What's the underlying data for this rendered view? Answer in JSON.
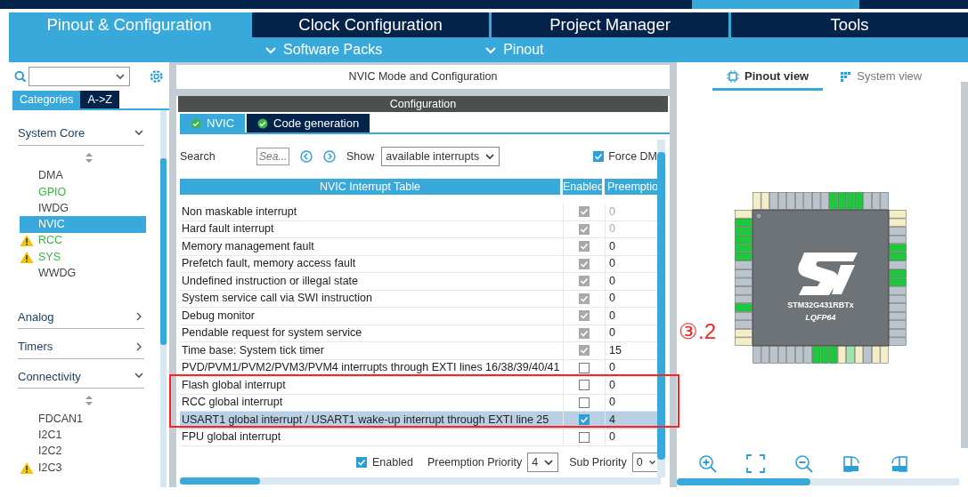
{
  "main_tabs": [
    {
      "label": "Pinout & Configuration",
      "selected": true
    },
    {
      "label": "Clock Configuration",
      "selected": false
    },
    {
      "label": "Project Manager",
      "selected": false
    },
    {
      "label": "Tools",
      "selected": false
    }
  ],
  "sub_menus": [
    {
      "label": "Software Packs"
    },
    {
      "label": "Pinout"
    }
  ],
  "sidebar": {
    "view_tabs": [
      {
        "label": "Categories",
        "selected": true
      },
      {
        "label": "A->Z",
        "selected": false
      }
    ],
    "categories": [
      {
        "label": "System Core",
        "expanded": true,
        "items": [
          {
            "label": "DMA",
            "selected": false,
            "configured": false,
            "warning": false
          },
          {
            "label": "GPIO",
            "selected": false,
            "configured": true,
            "warning": false
          },
          {
            "label": "IWDG",
            "selected": false,
            "configured": false,
            "warning": false
          },
          {
            "label": "NVIC",
            "selected": true,
            "configured": false,
            "warning": false
          },
          {
            "label": "RCC",
            "selected": false,
            "configured": true,
            "warning": true
          },
          {
            "label": "SYS",
            "selected": false,
            "configured": true,
            "warning": true
          },
          {
            "label": "WWDG",
            "selected": false,
            "configured": false,
            "warning": false
          }
        ]
      },
      {
        "label": "Analog",
        "expanded": false
      },
      {
        "label": "Timers",
        "expanded": false
      },
      {
        "label": "Connectivity",
        "expanded": true,
        "items": [
          {
            "label": "FDCAN1",
            "selected": false,
            "configured": false,
            "warning": false
          },
          {
            "label": "I2C1",
            "selected": false,
            "configured": false,
            "warning": false
          },
          {
            "label": "I2C2",
            "selected": false,
            "configured": false,
            "warning": false
          },
          {
            "label": "I2C3",
            "selected": false,
            "configured": false,
            "warning": true
          }
        ]
      }
    ]
  },
  "mode_panel": {
    "title": "NVIC Mode and Configuration",
    "section_title": "Configuration",
    "tabs": [
      {
        "label": "NVIC",
        "selected": true
      },
      {
        "label": "Code generation",
        "selected": false
      }
    ],
    "search": {
      "label": "Search",
      "placeholder": "Sea..."
    },
    "show": {
      "label": "Show",
      "value": "available interrupts"
    },
    "force_dma": {
      "label": "Force DM",
      "checked": true
    },
    "table": {
      "title": "NVIC Interrupt Table",
      "columns": [
        "Enabled",
        "Preemptio"
      ],
      "rows": [
        {
          "name": "Non maskable interrupt",
          "enabled": true,
          "locked": true,
          "priority": "0",
          "priority_locked": true,
          "selected": false
        },
        {
          "name": "Hard fault interrupt",
          "enabled": true,
          "locked": true,
          "priority": "0",
          "priority_locked": true,
          "selected": false
        },
        {
          "name": "Memory management fault",
          "enabled": true,
          "locked": true,
          "priority": "0",
          "priority_locked": false,
          "selected": false
        },
        {
          "name": "Prefetch fault, memory access fault",
          "enabled": true,
          "locked": true,
          "priority": "0",
          "priority_locked": false,
          "selected": false
        },
        {
          "name": "Undefined instruction or illegal state",
          "enabled": true,
          "locked": true,
          "priority": "0",
          "priority_locked": false,
          "selected": false
        },
        {
          "name": "System service call via SWI instruction",
          "enabled": true,
          "locked": true,
          "priority": "0",
          "priority_locked": false,
          "selected": false
        },
        {
          "name": "Debug monitor",
          "enabled": true,
          "locked": true,
          "priority": "0",
          "priority_locked": false,
          "selected": false
        },
        {
          "name": "Pendable request for system service",
          "enabled": true,
          "locked": true,
          "priority": "0",
          "priority_locked": false,
          "selected": false
        },
        {
          "name": "Time base: System tick timer",
          "enabled": true,
          "locked": true,
          "priority": "15",
          "priority_locked": false,
          "selected": false
        },
        {
          "name": "PVD/PVM1/PVM2/PVM3/PVM4 interrupts through EXTI lines 16/38/39/40/41",
          "enabled": false,
          "locked": false,
          "priority": "0",
          "priority_locked": false,
          "selected": false
        },
        {
          "name": "Flash global interrupt",
          "enabled": false,
          "locked": false,
          "priority": "0",
          "priority_locked": false,
          "selected": false
        },
        {
          "name": "RCC global interrupt",
          "enabled": false,
          "locked": false,
          "priority": "0",
          "priority_locked": false,
          "selected": false
        },
        {
          "name": "USART1 global interrupt / USART1 wake-up interrupt through EXTI line 25",
          "enabled": true,
          "locked": false,
          "priority": "4",
          "priority_locked": false,
          "selected": true
        },
        {
          "name": "FPU global interrupt",
          "enabled": false,
          "locked": false,
          "priority": "0",
          "priority_locked": false,
          "selected": false
        }
      ]
    },
    "footer": {
      "enabled": {
        "label": "Enabled",
        "checked": true
      },
      "preemption": {
        "label": "Preemption Priority",
        "value": "4"
      },
      "sub": {
        "label": "Sub Priority",
        "value": "0"
      }
    }
  },
  "pinout_panel": {
    "tabs": [
      {
        "label": "Pinout view",
        "selected": true
      },
      {
        "label": "System view",
        "selected": false
      }
    ],
    "chip": {
      "part_number": "STM32G431RBTx",
      "package": "LQFP64",
      "pins": {
        "top": [
          {
            "kind": "power"
          },
          {
            "kind": "power"
          },
          {
            "kind": "io"
          },
          {
            "kind": "io"
          },
          {
            "kind": "io"
          },
          {
            "kind": "io"
          },
          {
            "kind": "io"
          },
          {
            "kind": "io"
          },
          {
            "kind": "io"
          },
          {
            "kind": "used"
          },
          {
            "kind": "used"
          },
          {
            "kind": "used"
          },
          {
            "kind": "used"
          },
          {
            "kind": "io"
          },
          {
            "kind": "io"
          },
          {
            "kind": "io"
          }
        ],
        "left": [
          {
            "kind": "power"
          },
          {
            "kind": "used"
          },
          {
            "kind": "used"
          },
          {
            "kind": "used"
          },
          {
            "kind": "used"
          },
          {
            "kind": "used"
          },
          {
            "kind": "io"
          },
          {
            "kind": "io"
          },
          {
            "kind": "io"
          },
          {
            "kind": "io"
          },
          {
            "kind": "io"
          },
          {
            "kind": "used"
          },
          {
            "kind": "io"
          },
          {
            "kind": "io"
          },
          {
            "kind": "power"
          },
          {
            "kind": "power"
          }
        ],
        "right": [
          {
            "kind": "power"
          },
          {
            "kind": "power"
          },
          {
            "kind": "io"
          },
          {
            "kind": "io"
          },
          {
            "kind": "used"
          },
          {
            "kind": "used"
          },
          {
            "kind": "io"
          },
          {
            "kind": "used"
          },
          {
            "kind": "used"
          },
          {
            "kind": "io"
          },
          {
            "kind": "io"
          },
          {
            "kind": "io"
          },
          {
            "kind": "io"
          },
          {
            "kind": "io"
          },
          {
            "kind": "io"
          },
          {
            "kind": "io"
          }
        ],
        "bottom": [
          {
            "kind": "io"
          },
          {
            "kind": "io"
          },
          {
            "kind": "io"
          },
          {
            "kind": "io"
          },
          {
            "kind": "io"
          },
          {
            "kind": "io"
          },
          {
            "kind": "io"
          },
          {
            "kind": "used"
          },
          {
            "kind": "used"
          },
          {
            "kind": "used"
          },
          {
            "kind": "power"
          },
          {
            "kind": "reference"
          },
          {
            "kind": "power"
          },
          {
            "kind": "io"
          },
          {
            "kind": "power"
          },
          {
            "kind": "power"
          }
        ]
      }
    }
  },
  "annotations": [
    {
      "kind": "box"
    },
    {
      "kind": "label",
      "text": "③.2"
    }
  ]
}
